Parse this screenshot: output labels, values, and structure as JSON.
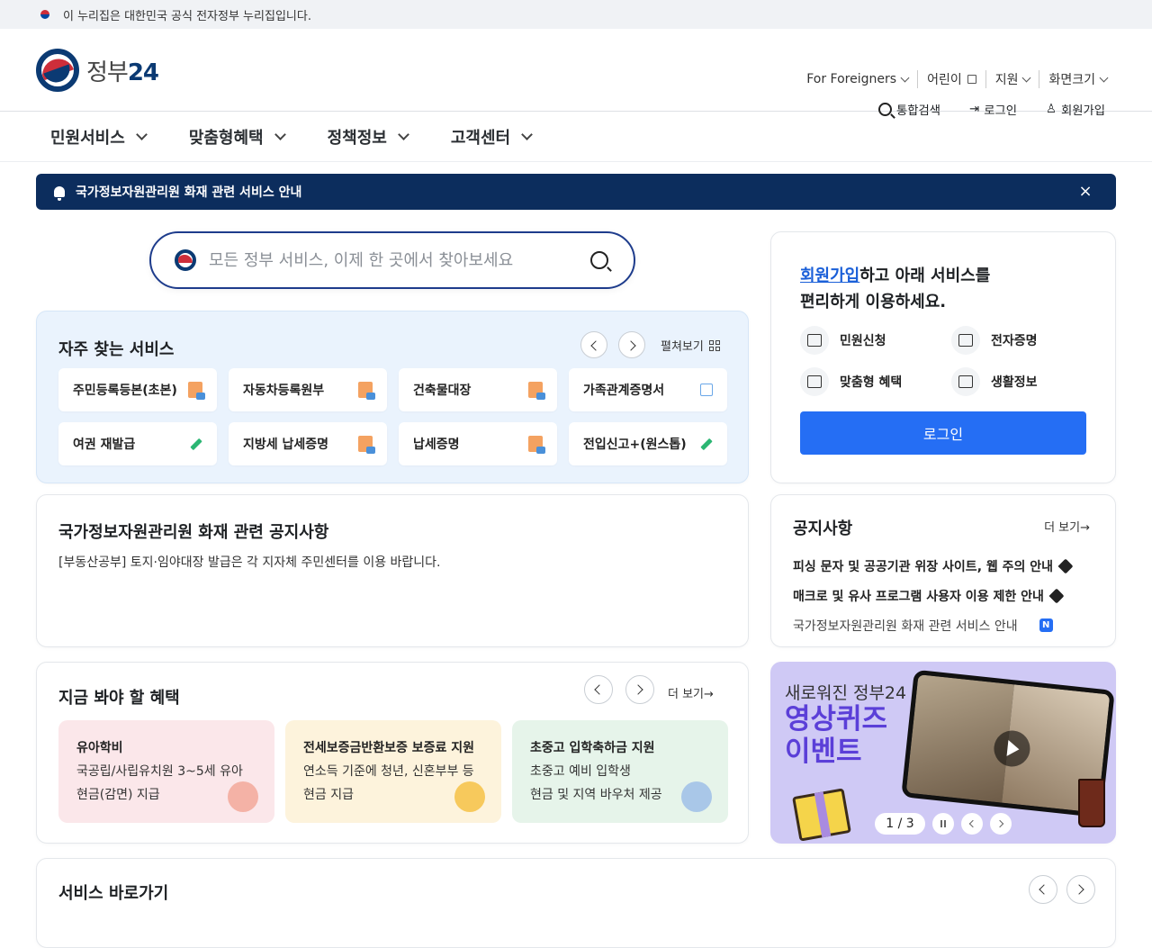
{
  "topbar": {
    "text": "이 누리집은 대한민국 공식 전자정부 누리집입니다."
  },
  "header": {
    "logo_text_a": "정부",
    "logo_text_b": "24",
    "utility": [
      "For Foreigners",
      "어린이",
      "지원",
      "화면크기"
    ],
    "actions": {
      "search": "통합검색",
      "login": "로그인",
      "signup": "회원가입"
    }
  },
  "gnb": [
    "민원서비스",
    "맞춤형혜택",
    "정책정보",
    "고객센터"
  ],
  "alert": {
    "text": "국가정보자원관리원 화재 관련 서비스 안내",
    "close": "×"
  },
  "search": {
    "placeholder": "모든 정부 서비스, 이제 한 곳에서 찾아보세요"
  },
  "frequent": {
    "title": "자주 찾는 서비스",
    "expand": "펼쳐보기",
    "items": [
      {
        "label": "주민등록등본(초본)",
        "icon": "document-icon"
      },
      {
        "label": "자동차등록원부",
        "icon": "document-icon"
      },
      {
        "label": "건축물대장",
        "icon": "document-icon"
      },
      {
        "label": "가족관계증명서",
        "icon": "external-link-icon"
      },
      {
        "label": "여권 재발급",
        "icon": "pen-icon"
      },
      {
        "label": "지방세 납세증명",
        "icon": "document-icon"
      },
      {
        "label": "납세증명",
        "icon": "document-icon"
      },
      {
        "label": "전입신고+(원스톱)",
        "icon": "pen-icon"
      }
    ]
  },
  "login_card": {
    "title_link": "회원가입",
    "title_rest": "하고 아래 서비스를",
    "title_line2": "편리하게 이용하세요.",
    "services": [
      "민원신청",
      "전자증명",
      "맞춤형 혜택",
      "생활정보"
    ],
    "button": "로그인"
  },
  "notice_main": {
    "title": "국가정보자원관리원 화재 관련 공지사항",
    "body": "[부동산공부] 토지·임야대장 발급은 각 지자체 주민센터를 이용 바랍니다."
  },
  "notice": {
    "title": "공지사항",
    "more": "더 보기→",
    "items": [
      {
        "text": "피싱 문자 및 공공기관 위장 사이트, 웹 주의 안내",
        "pinned": true
      },
      {
        "text": "매크로 및 유사 프로그램 사용자 이용 제한 안내",
        "pinned": true
      },
      {
        "text": "국가정보자원관리원 화재 관련 서비스 안내",
        "badge": "N"
      }
    ]
  },
  "benefits": {
    "title": "지금 봐야 할 혜택",
    "more": "더 보기→",
    "cards": [
      {
        "title": "유아학비",
        "line1": "국공립/사립유치원 3~5세 유아",
        "line2": "현금(감면) 지급"
      },
      {
        "title": "전세보증금반환보증 보증료 지원",
        "line1": "연소득 기준에 청년, 신혼부부 등",
        "line2": "현금 지급"
      },
      {
        "title": "초중고 입학축하금 지원",
        "line1": "초중고 예비 입학생",
        "line2": "현금 및 지역 바우처 제공"
      }
    ]
  },
  "promo": {
    "subtitle": "새로워진 정부24",
    "title": "영상퀴즈 이벤트",
    "pager": "1 / 3"
  },
  "shortcut": {
    "title": "서비스 바로가기"
  }
}
